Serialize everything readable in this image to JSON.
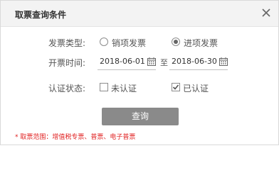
{
  "dialog": {
    "title": "取票查询条件",
    "close_icon": "close-icon"
  },
  "invoice_type": {
    "label": "发票类型:",
    "options": [
      {
        "label": "销项发票",
        "checked": false
      },
      {
        "label": "进项发票",
        "checked": true
      }
    ]
  },
  "issue_date": {
    "label": "开票时间:",
    "start": "2018-06-01",
    "separator": "至",
    "end": "2018-06-30",
    "calendar_icon": "calendar-icon"
  },
  "auth_status": {
    "label": "认证状态:",
    "options": [
      {
        "label": "未认证",
        "checked": false
      },
      {
        "label": "已认证",
        "checked": true
      }
    ]
  },
  "actions": {
    "query_label": "查询"
  },
  "note": "* 取票范围：增值税专票、普票、电子普票",
  "colors": {
    "header_bg": "#f3f3f3",
    "button_bg": "#8a8a8a",
    "note_text": "#e02020"
  }
}
